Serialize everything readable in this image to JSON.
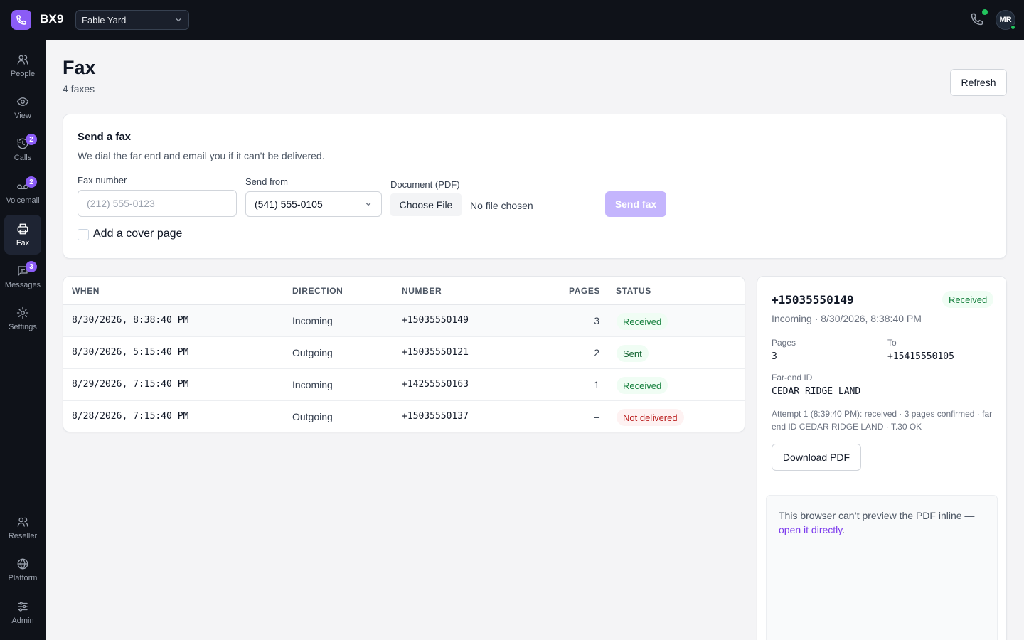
{
  "app": {
    "brand": "BX9",
    "org": "Fable Yard",
    "user_initials": "MR"
  },
  "sidebar": {
    "items": [
      {
        "label": "People",
        "icon": "people-icon",
        "badge": ""
      },
      {
        "label": "View",
        "icon": "eye-icon",
        "badge": ""
      },
      {
        "label": "Calls",
        "icon": "history-icon",
        "badge": "2"
      },
      {
        "label": "Voicemail",
        "icon": "voicemail-icon",
        "badge": "2"
      },
      {
        "label": "Fax",
        "icon": "printer-icon",
        "badge": ""
      },
      {
        "label": "Messages",
        "icon": "message-icon",
        "badge": "3"
      },
      {
        "label": "Settings",
        "icon": "gear-icon",
        "badge": ""
      }
    ],
    "bottom_items": [
      {
        "label": "Reseller",
        "icon": "people-icon"
      },
      {
        "label": "Platform",
        "icon": "globe-icon"
      },
      {
        "label": "Admin",
        "icon": "sliders-icon"
      }
    ]
  },
  "header": {
    "title": "Fax",
    "subtitle": "4 faxes",
    "refresh_label": "Refresh"
  },
  "send_form": {
    "title": "Send a fax",
    "subtitle": "We dial the far end and email you if it can’t be delivered.",
    "fax_number_label": "Fax number",
    "fax_number_placeholder": "(212) 555-0123",
    "send_from_label": "Send from",
    "send_from_value": "(541) 555-0105",
    "document_label": "Document (PDF)",
    "choose_file_label": "Choose File",
    "file_status": "No file chosen",
    "send_label": "Send fax",
    "cover_page_label": "Add a cover page"
  },
  "table": {
    "headers": {
      "when": "WHEN",
      "direction": "DIRECTION",
      "number": "NUMBER",
      "pages": "PAGES",
      "status": "STATUS"
    },
    "rows": [
      {
        "when": "8/30/2026, 8:38:40 PM",
        "direction": "Incoming",
        "number": "+15035550149",
        "pages": "3",
        "status": "Received"
      },
      {
        "when": "8/30/2026, 5:15:40 PM",
        "direction": "Outgoing",
        "number": "+15035550121",
        "pages": "2",
        "status": "Sent"
      },
      {
        "when": "8/29/2026, 7:15:40 PM",
        "direction": "Incoming",
        "number": "+14255550163",
        "pages": "1",
        "status": "Received"
      },
      {
        "when": "8/28/2026, 7:15:40 PM",
        "direction": "Outgoing",
        "number": "+15035550137",
        "pages": "–",
        "status": "Not delivered"
      }
    ]
  },
  "detail": {
    "number": "+15035550149",
    "status": "Received",
    "meta": "Incoming · 8/30/2026, 8:38:40 PM",
    "pages_label": "Pages",
    "pages_value": "3",
    "to_label": "To",
    "to_value": "+15415550105",
    "far_end_label": "Far-end ID",
    "far_end_value": "CEDAR RIDGE LAND",
    "attempt": "Attempt 1 (8:39:40 PM): received · 3 pages confirmed · far end ID CEDAR RIDGE LAND · T.30 OK",
    "download_label": "Download PDF",
    "preview_text": "This browser can’t preview the PDF inline —",
    "preview_link": "open it directly",
    "preview_end": "."
  },
  "colors": {
    "accent": "#8b5cf6",
    "topbar": "#0f1219",
    "success": "#15803d",
    "danger": "#b91c1c"
  }
}
